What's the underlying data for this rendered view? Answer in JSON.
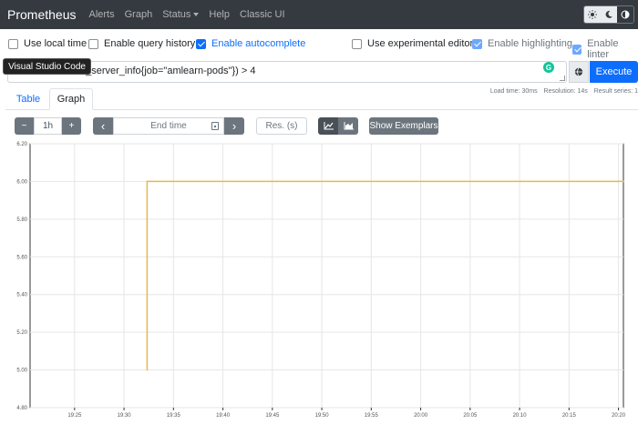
{
  "navbar": {
    "brand": "Prometheus",
    "links": [
      "Alerts",
      "Graph",
      "Status",
      "Help",
      "Classic UI"
    ],
    "theme_icons": [
      "sun-icon",
      "moon-icon",
      "contrast-icon"
    ],
    "bg_color": "#343a40"
  },
  "options": {
    "use_local_time": {
      "label": "Use local time",
      "checked": false
    },
    "query_history": {
      "label": "Enable query history",
      "checked": false
    },
    "autocomplete": {
      "label": "Enable autocomplete",
      "checked": true
    },
    "experimental_editor": {
      "label": "Use experimental editor",
      "checked": false
    },
    "highlighting": {
      "label": "Enable highlighting",
      "checked": true
    },
    "linter": {
      "label": "Enable linter",
      "checked": true
    }
  },
  "query": {
    "expression": "n_server_info{job=\"amlearn-pods\"}) > 4",
    "execute_label": "Execute",
    "tooltip": "Visual Studio Code"
  },
  "stats": {
    "load_time": "Load time: 30ms",
    "resolution": "Resolution: 14s",
    "result_series": "Result series: 1"
  },
  "tabs": {
    "table": "Table",
    "graph": "Graph"
  },
  "graph_controls": {
    "minus": "−",
    "range": "1h",
    "plus": "+",
    "prev": "‹",
    "end_time_placeholder": "End time",
    "next": "›",
    "resolution_placeholder": "Res. (s)",
    "show_exemplars": "Show Exemplars"
  },
  "colors": {
    "accent": "#0d6efd",
    "series": "#e8b84a",
    "grid": "#e6e6e6"
  },
  "chart_data": {
    "type": "line",
    "x_ticks": [
      "19:25",
      "19:30",
      "19:35",
      "19:40",
      "19:45",
      "19:50",
      "19:55",
      "20:00",
      "20:05",
      "20:10",
      "20:15",
      "20:20"
    ],
    "y_ticks": [
      "6.20",
      "6.00",
      "5.80",
      "5.60",
      "5.40",
      "5.20",
      "5.00",
      "4.80"
    ],
    "ylim": [
      4.8,
      6.2
    ],
    "xlim": [
      "19:20:30",
      "20:20:30"
    ],
    "series": [
      {
        "color": "#e8b84a",
        "points": [
          {
            "x": "19:32:20",
            "y": 5.0
          },
          {
            "x": "19:32:20",
            "y": 6.0
          },
          {
            "x": "20:20:30",
            "y": 6.0
          }
        ]
      }
    ],
    "grid": true
  }
}
